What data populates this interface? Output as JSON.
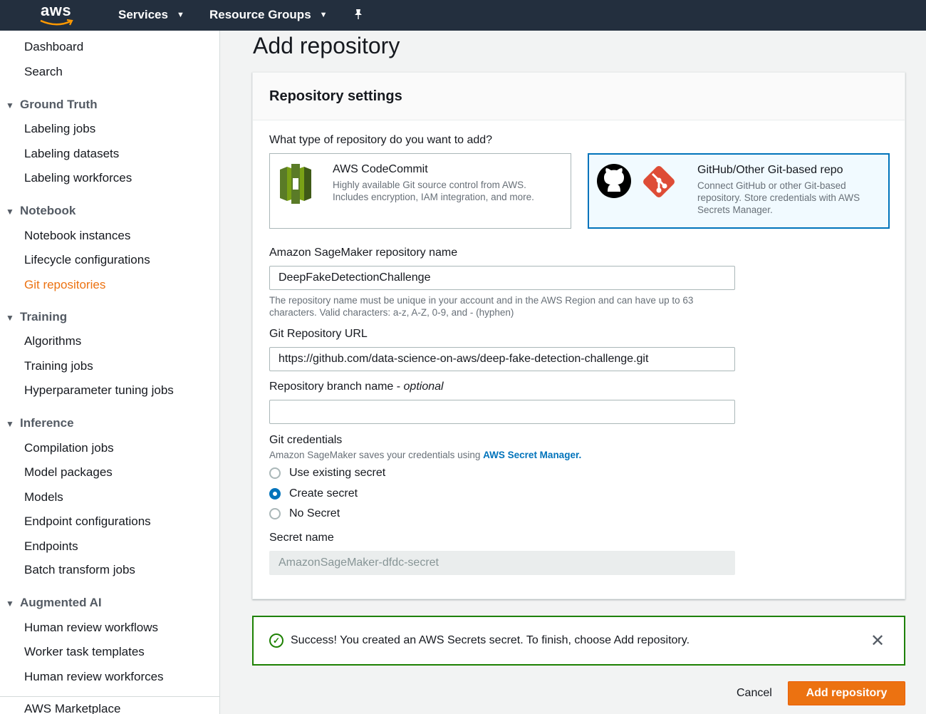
{
  "topnav": {
    "logo_text": "aws",
    "services": "Services",
    "resource_groups": "Resource Groups"
  },
  "sidebar": {
    "top_links": [
      "Dashboard",
      "Search"
    ],
    "sections": [
      {
        "title": "Ground Truth",
        "items": [
          "Labeling jobs",
          "Labeling datasets",
          "Labeling workforces"
        ]
      },
      {
        "title": "Notebook",
        "items": [
          "Notebook instances",
          "Lifecycle configurations",
          "Git repositories"
        ]
      },
      {
        "title": "Training",
        "items": [
          "Algorithms",
          "Training jobs",
          "Hyperparameter tuning jobs"
        ]
      },
      {
        "title": "Inference",
        "items": [
          "Compilation jobs",
          "Model packages",
          "Models",
          "Endpoint configurations",
          "Endpoints",
          "Batch transform jobs"
        ]
      },
      {
        "title": "Augmented AI",
        "items": [
          "Human review workflows",
          "Worker task templates",
          "Human review workforces"
        ]
      }
    ],
    "marketplace": "AWS Marketplace",
    "active_item": "Git repositories"
  },
  "page": {
    "title": "Add repository"
  },
  "panel": {
    "title": "Repository settings",
    "repo_type_question": "What type of repository do you want to add?",
    "codecommit": {
      "title": "AWS CodeCommit",
      "desc": "Highly available Git source control from AWS. Includes encryption, IAM integration, and more."
    },
    "github": {
      "title": "GitHub/Other Git-based repo",
      "desc": "Connect GitHub or other Git-based repository. Store credentials with AWS Secrets Manager."
    },
    "repo_name_label": "Amazon SageMaker repository name",
    "repo_name_value": "DeepFakeDetectionChallenge",
    "repo_name_hint": "The repository name must be unique in your account and in the AWS Region and can have up to 63 characters. Valid characters: a-z, A-Z, 0-9, and - (hyphen)",
    "git_url_label": "Git Repository URL",
    "git_url_value": "https://github.com/data-science-on-aws/deep-fake-detection-challenge.git",
    "branch_label": "Repository branch name - ",
    "branch_optional": "optional",
    "branch_value": "",
    "credentials_label": "Git credentials",
    "credentials_hint": "Amazon SageMaker saves your credentials using ",
    "credentials_link": "AWS Secret Manager.",
    "radio_options": [
      "Use existing secret",
      "Create secret",
      "No Secret"
    ],
    "selected_radio": "Create secret",
    "secret_name_label": "Secret name",
    "secret_name_value": "AmazonSageMaker-dfdc-secret"
  },
  "flash": {
    "message": "Success! You created an AWS Secrets secret. To finish, choose Add repository."
  },
  "footer": {
    "cancel": "Cancel",
    "submit": "Add repository"
  },
  "colors": {
    "nav_bg": "#232f3e",
    "accent": "#ec7211",
    "link": "#0073bb",
    "success": "#1d8102"
  }
}
